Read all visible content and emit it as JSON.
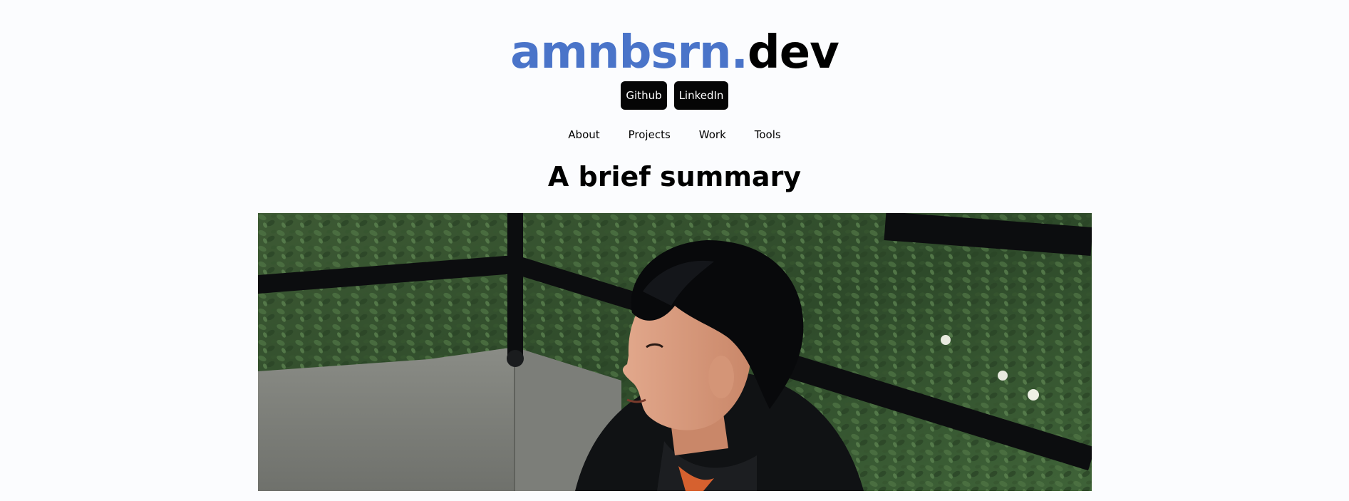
{
  "header": {
    "brand": "amnbsrn.",
    "tld": "dev"
  },
  "social": {
    "github_label": "Github",
    "linkedin_label": "LinkedIn"
  },
  "nav": {
    "items": [
      {
        "label": "About"
      },
      {
        "label": "Projects"
      },
      {
        "label": "Work"
      },
      {
        "label": "Tools"
      }
    ]
  },
  "main": {
    "heading": "A brief summary"
  },
  "colors": {
    "brand_blue": "#4a74c9",
    "background": "#fbfcfe",
    "button_bg": "#050505"
  }
}
